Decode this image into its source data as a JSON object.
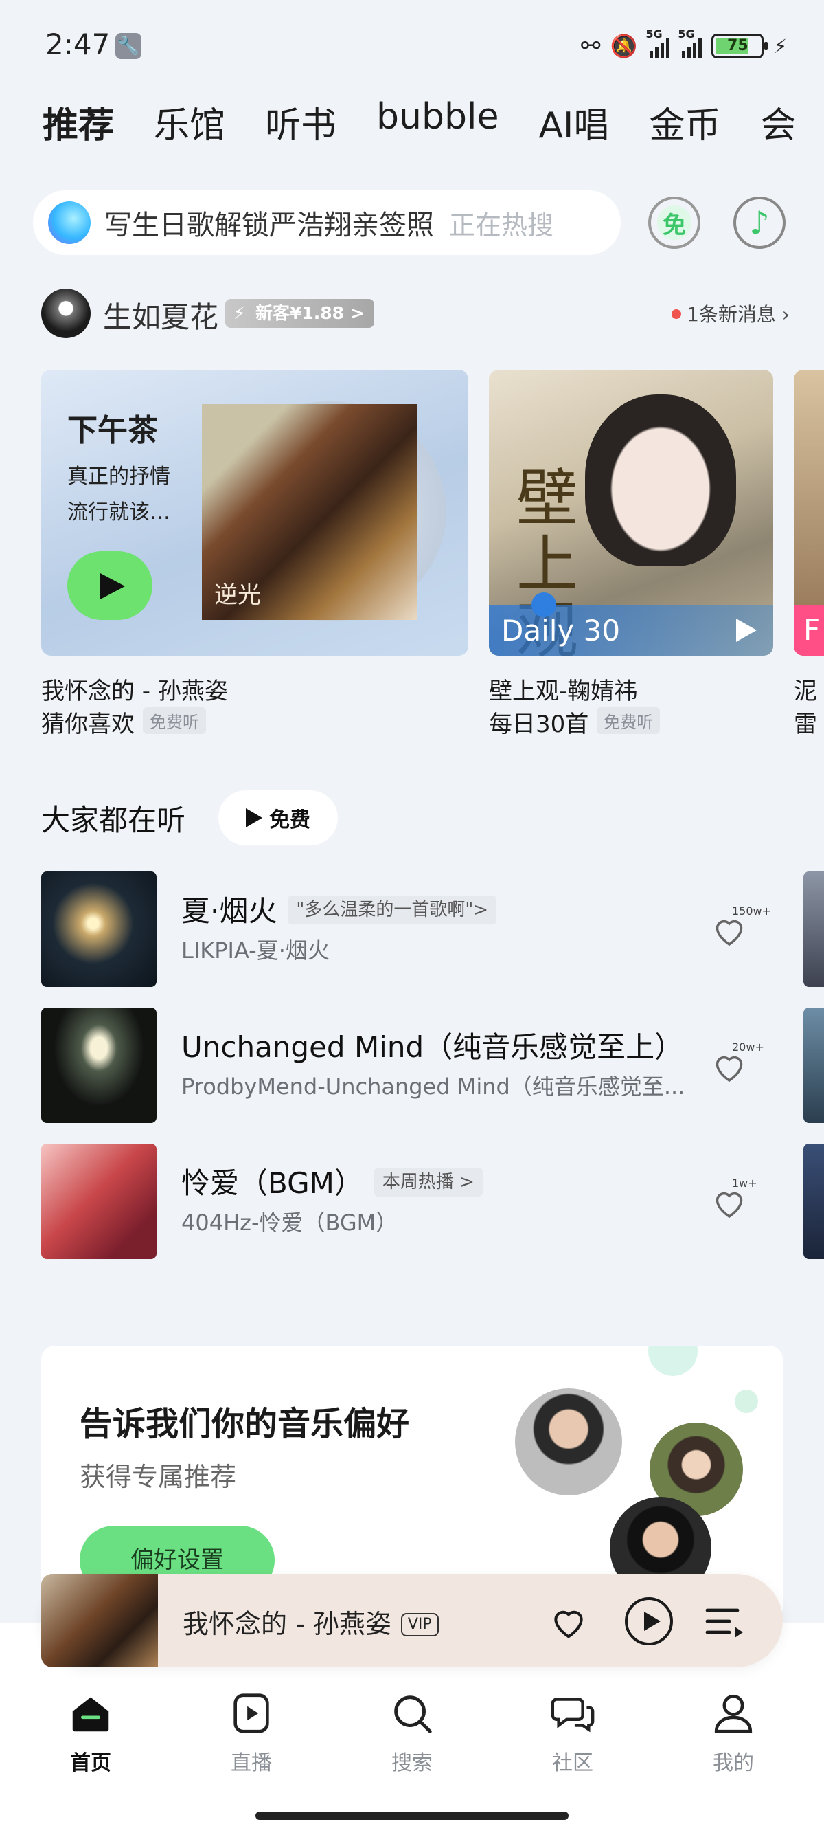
{
  "status": {
    "time": "2:47",
    "net1": "5G",
    "net2": "5G",
    "battery": "75"
  },
  "tabs": [
    "推荐",
    "乐馆",
    "听书",
    "bubble",
    "AI唱",
    "金币",
    "会"
  ],
  "search": {
    "query": "写生日歌解锁严浩翔亲签照",
    "hint": "正在热搜",
    "free_label": "免"
  },
  "user": {
    "name": "生如夏花",
    "badge": "新客¥1.88 >",
    "messages": "1条新消息"
  },
  "cards": [
    {
      "title": "下午茶",
      "subtitle": "真正的抒情流行就该…",
      "cover_text": "逆光",
      "caption": "我怀念的 - 孙燕姿",
      "caption2": "猜你喜欢",
      "tag": "免费听"
    },
    {
      "art_text": "壁上观",
      "label": "Daily 30",
      "caption": "壁上观-鞠婧祎",
      "caption2": "每日30首",
      "tag": "免费听"
    },
    {
      "label": "F",
      "caption": "泥",
      "caption2": "雷"
    }
  ],
  "section": {
    "title": "大家都在听",
    "free_button": "免费"
  },
  "songs": [
    {
      "title": "夏·烟火",
      "chip": "\"多么温柔的一首歌啊\">",
      "artist": "LIKPIA-夏·烟火",
      "count": "150w+"
    },
    {
      "title": "Unchanged Mind（纯音乐感觉至上）",
      "chip": "",
      "artist": "ProdbyMend-Unchanged Mind（纯音乐感觉至...",
      "count": "20w+"
    },
    {
      "title": "怜爱（BGM）",
      "chip": "本周热播 >",
      "artist": "404Hz-怜爱（BGM）",
      "count": "1w+"
    }
  ],
  "preference": {
    "heading": "告诉我们你的音乐偏好",
    "subheading": "获得专属推荐",
    "button": "偏好设置"
  },
  "player": {
    "title": "我怀念的 - 孙燕姿",
    "vip": "VIP"
  },
  "nav": [
    "首页",
    "直播",
    "搜索",
    "社区",
    "我的"
  ],
  "colors": {
    "accent": "#6be082",
    "background": "#f0f3f7"
  }
}
